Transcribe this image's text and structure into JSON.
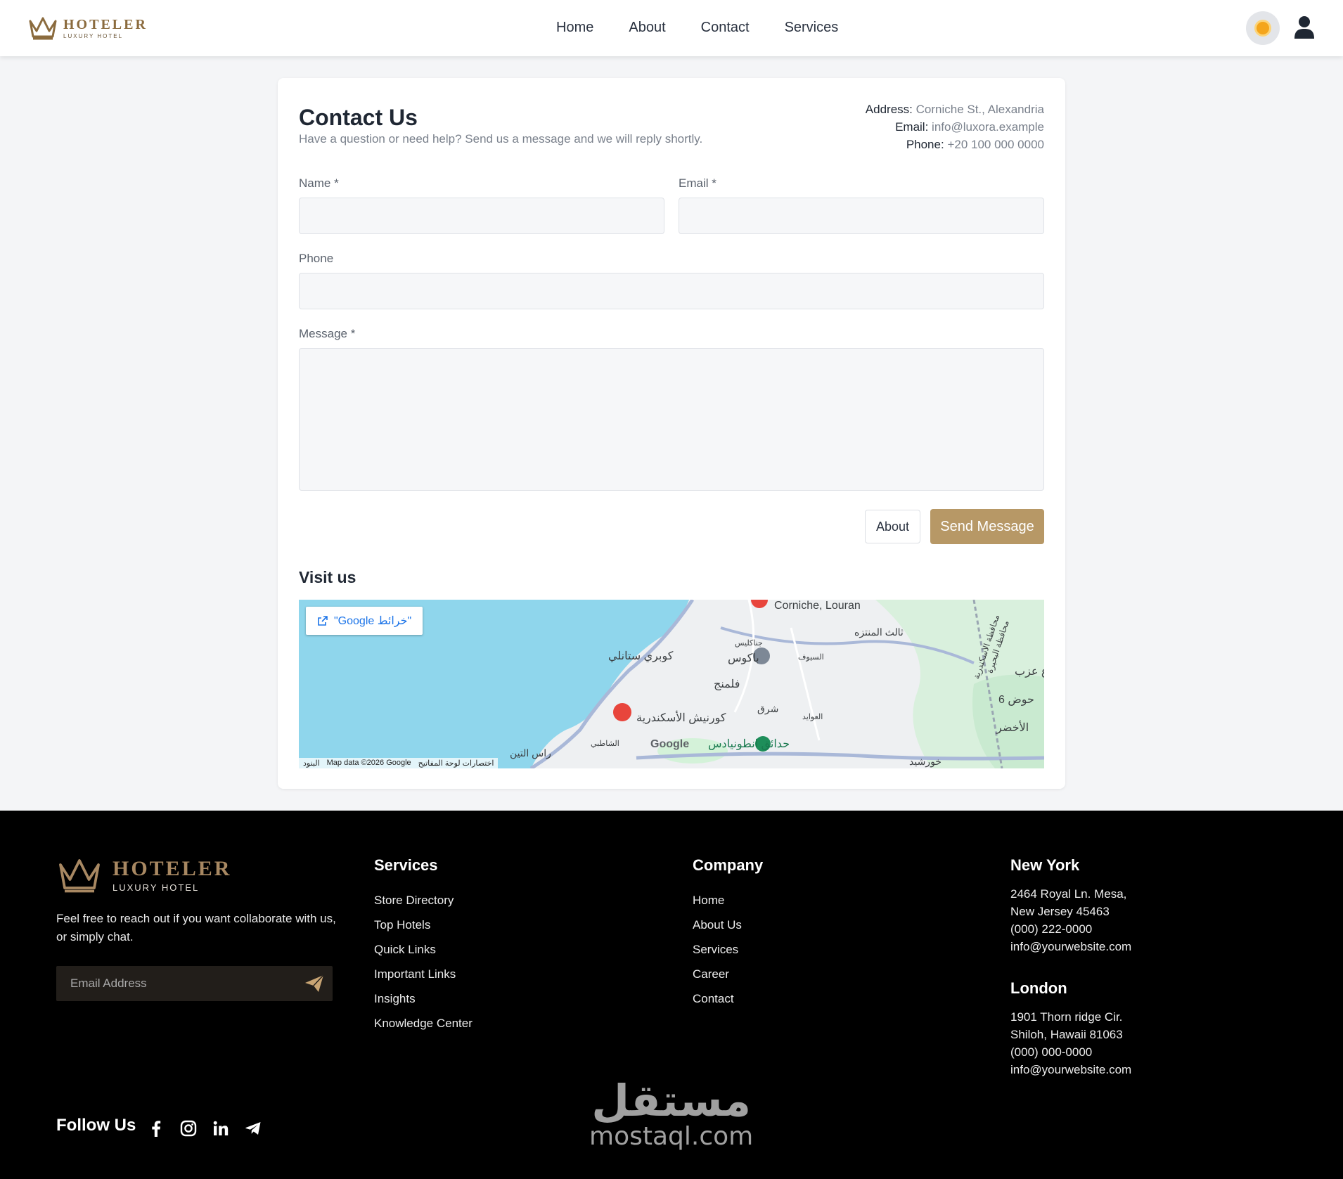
{
  "header": {
    "brand": "HOTELER",
    "tagline": "LUXURY HOTEL",
    "nav": [
      "Home",
      "About",
      "Contact",
      "Services"
    ]
  },
  "contact": {
    "title": "Contact Us",
    "subtitle": "Have a question or need help? Send us a message and we will reply shortly.",
    "address_label": "Address:",
    "address_value": "Corniche St., Alexandria",
    "email_label": "Email:",
    "email_value": "info@luxora.example",
    "phone_label": "Phone:",
    "phone_value": "+20 100 000 0000",
    "form": {
      "name_label": "Name *",
      "name_value": "",
      "email_label": "Email *",
      "email_value": "",
      "phone_label": "Phone",
      "phone_value": "",
      "message_label": "Message *",
      "message_value": ""
    },
    "about_button": "About",
    "send_button": "Send Message",
    "visit_title": "Visit us"
  },
  "map": {
    "open_button": "\"Google خرائط\"",
    "attribution": [
      "البنود",
      "Map data ©2026 Google",
      "اختصارات لوحة المفاتيح"
    ],
    "labels": [
      "Corniche, Louran",
      "ثالث المنتزه",
      "كوبري ستانلي",
      "باكوس",
      "فلمنج",
      "كورنيش الأسكندرية",
      "حدائق انطونيادس",
      "شرق",
      "راس التين",
      "الشاطبي",
      "العوايد",
      "السيوف",
      "جناكليس",
      "حوض 6",
      "ع عزب",
      "الأخضر",
      "خورشيد",
      "محافظة الاسكندرية",
      "محافظة البحيرة"
    ],
    "google_logo": "Google"
  },
  "footer": {
    "brand": "HOTELER",
    "tagline": "LUXURY HOTEL",
    "description": "Feel free to reach out if you want collaborate with us, or simply chat.",
    "email_placeholder": "Email Address",
    "services_title": "Services",
    "services": [
      "Store Directory",
      "Top Hotels",
      "Quick Links",
      "Important Links",
      "Insights",
      "Knowledge Center"
    ],
    "company_title": "Company",
    "company": [
      "Home",
      "About Us",
      "Services",
      "Career",
      "Contact"
    ],
    "ny_title": "New York",
    "ny_lines": [
      "2464 Royal Ln. Mesa,",
      "New Jersey 45463",
      "(000) 222-0000",
      "info@yourwebsite.com"
    ],
    "london_title": "London",
    "london_lines": [
      "1901 Thorn ridge Cir.",
      "Shiloh, Hawaii 81063",
      "(000) 000-0000",
      "info@yourwebsite.com"
    ],
    "follow_title": "Follow Us",
    "socials": [
      "facebook-icon",
      "instagram-icon",
      "linkedin-icon",
      "telegram-icon"
    ]
  },
  "watermark": {
    "arabic": "مستقل",
    "latin": "mostaql.com"
  },
  "colors": {
    "accent": "#b79866",
    "brand_gold": "#8b6b3e",
    "footer_bg": "#000000"
  }
}
